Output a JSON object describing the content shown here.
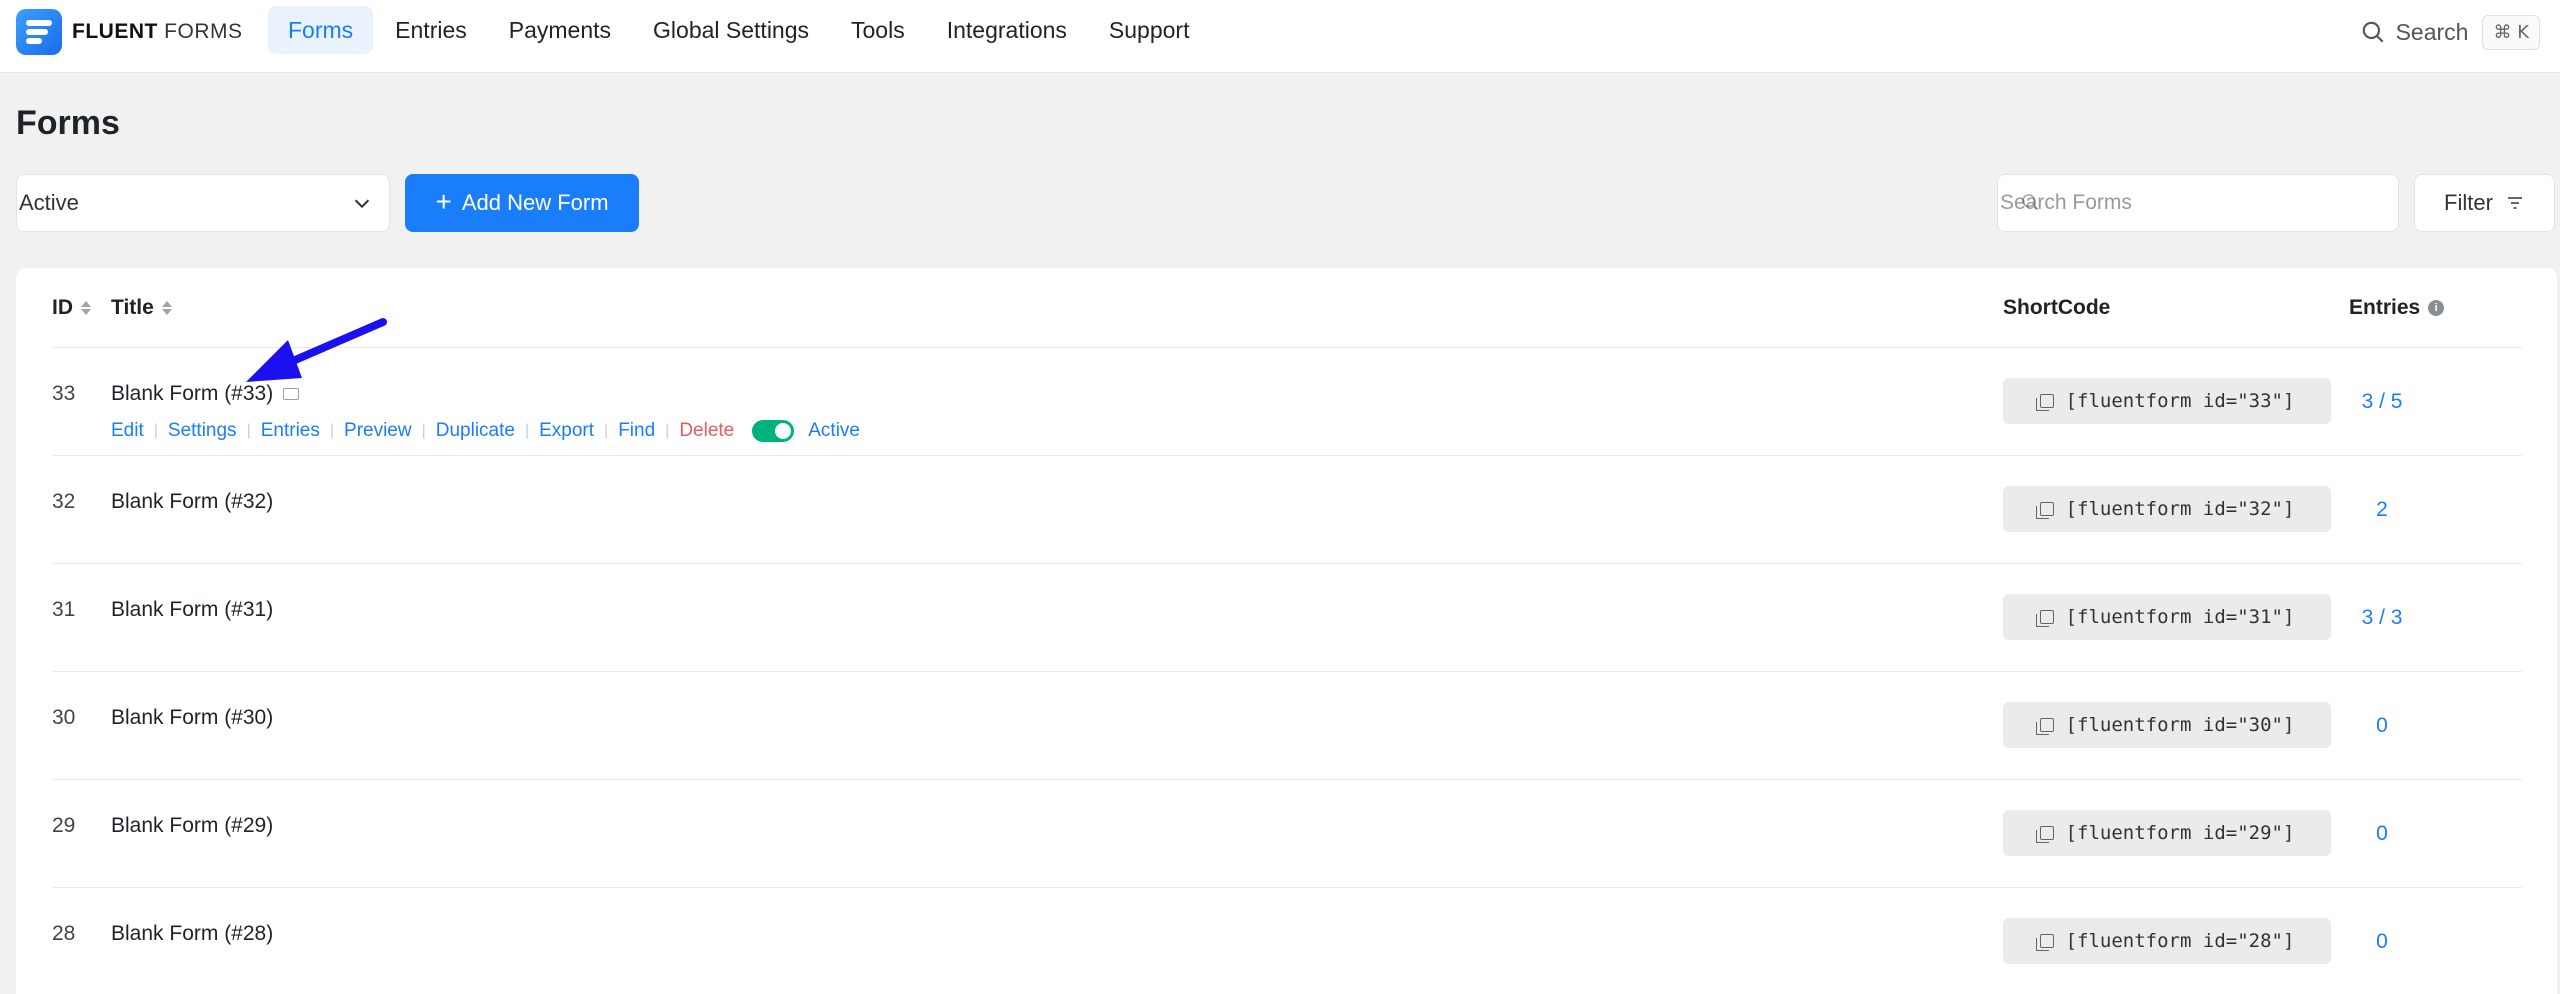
{
  "app": {
    "logo_bold": "FLUENT",
    "logo_light": "FORMS"
  },
  "nav": {
    "items": [
      "Forms",
      "Entries",
      "Payments",
      "Global Settings",
      "Tools",
      "Integrations",
      "Support"
    ],
    "active": "Forms",
    "search_label": "Search",
    "search_shortcut": "⌘ K"
  },
  "page": {
    "title": "Forms"
  },
  "toolbar": {
    "status_value": "Active",
    "add_label": "Add New Form",
    "search_placeholder": "Search Forms",
    "filter_label": "Filter"
  },
  "table": {
    "headers": {
      "id": "ID",
      "title": "Title",
      "shortcode": "ShortCode",
      "entries": "Entries"
    },
    "row_actions": [
      "Edit",
      "Settings",
      "Entries",
      "Preview",
      "Duplicate",
      "Export",
      "Find",
      "Delete"
    ],
    "active_label": "Active",
    "rows": [
      {
        "id": "33",
        "title": "Blank Form (#33)",
        "shortcode": "[fluentform id=\"33\"]",
        "entries": "3 / 5"
      },
      {
        "id": "32",
        "title": "Blank Form (#32)",
        "shortcode": "[fluentform id=\"32\"]",
        "entries": "2"
      },
      {
        "id": "31",
        "title": "Blank Form (#31)",
        "shortcode": "[fluentform id=\"31\"]",
        "entries": "3 / 3"
      },
      {
        "id": "30",
        "title": "Blank Form (#30)",
        "shortcode": "[fluentform id=\"30\"]",
        "entries": "0"
      },
      {
        "id": "29",
        "title": "Blank Form (#29)",
        "shortcode": "[fluentform id=\"29\"]",
        "entries": "0"
      },
      {
        "id": "28",
        "title": "Blank Form (#28)",
        "shortcode": "[fluentform id=\"28\"]",
        "entries": "0"
      }
    ]
  },
  "colors": {
    "accent": "#1a7efb",
    "danger": "#e25c5c",
    "toggle_on": "#00b27f",
    "annotation_arrow": "#1a10f0"
  }
}
